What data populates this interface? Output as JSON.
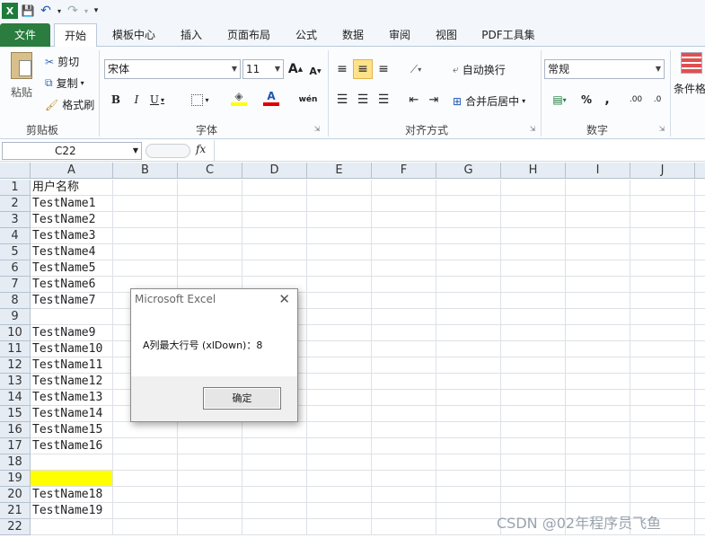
{
  "qat": {
    "logo": "X",
    "save": "💾",
    "undo": "↶",
    "redo": "↷",
    "customize": "▾"
  },
  "tabs": {
    "file": "文件",
    "home": "开始",
    "template": "模板中心",
    "insert": "插入",
    "layout": "页面布局",
    "formulas": "公式",
    "data": "数据",
    "review": "审阅",
    "view": "视图",
    "pdf": "PDF工具集"
  },
  "clipboard": {
    "paste": "粘贴",
    "cut": "剪切",
    "copy": "复制",
    "painter": "格式刷",
    "label": "剪贴板"
  },
  "font": {
    "name": "宋体",
    "size": "11",
    "bold": "B",
    "italic": "I",
    "underline": "U",
    "grow": "A",
    "shrink": "A",
    "label": "字体",
    "wen": "wén"
  },
  "alignment": {
    "wrap": "自动换行",
    "merge": "合并后居中",
    "label": "对齐方式"
  },
  "number": {
    "format": "常规",
    "percent": "%",
    "comma": ",",
    "inc": ".00",
    "label": "数字"
  },
  "styles": {
    "conditional": "条件格"
  },
  "formula_bar": {
    "cell_ref": "C22",
    "fx": "fx",
    "value": ""
  },
  "columns": [
    "A",
    "B",
    "C",
    "D",
    "E",
    "F",
    "G",
    "H",
    "I",
    "J"
  ],
  "rows": [
    {
      "n": "1",
      "a": "用户名称"
    },
    {
      "n": "2",
      "a": "TestName1"
    },
    {
      "n": "3",
      "a": "TestName2"
    },
    {
      "n": "4",
      "a": "TestName3"
    },
    {
      "n": "5",
      "a": "TestName4"
    },
    {
      "n": "6",
      "a": "TestName5"
    },
    {
      "n": "7",
      "a": "TestName6"
    },
    {
      "n": "8",
      "a": "TestName7"
    },
    {
      "n": "9",
      "a": ""
    },
    {
      "n": "10",
      "a": "TestName9"
    },
    {
      "n": "11",
      "a": "TestName10"
    },
    {
      "n": "12",
      "a": "TestName11"
    },
    {
      "n": "13",
      "a": "TestName12"
    },
    {
      "n": "14",
      "a": "TestName13"
    },
    {
      "n": "15",
      "a": "TestName14"
    },
    {
      "n": "16",
      "a": "TestName15"
    },
    {
      "n": "17",
      "a": "TestName16"
    },
    {
      "n": "18",
      "a": ""
    },
    {
      "n": "19",
      "a": "",
      "fill": "#ffff00"
    },
    {
      "n": "20",
      "a": "TestName18"
    },
    {
      "n": "21",
      "a": "TestName19"
    },
    {
      "n": "22",
      "a": ""
    }
  ],
  "dialog": {
    "title": "Microsoft Excel",
    "close": "✕",
    "message": "A列最大行号 (xlDown)：8",
    "ok": "确定"
  },
  "watermark": "CSDN @02年程序员飞鱼",
  "colors": {
    "file_tab": "#2a7c3f",
    "selected_fill": "#ffff00",
    "header_bg": "#e6ecf4"
  }
}
